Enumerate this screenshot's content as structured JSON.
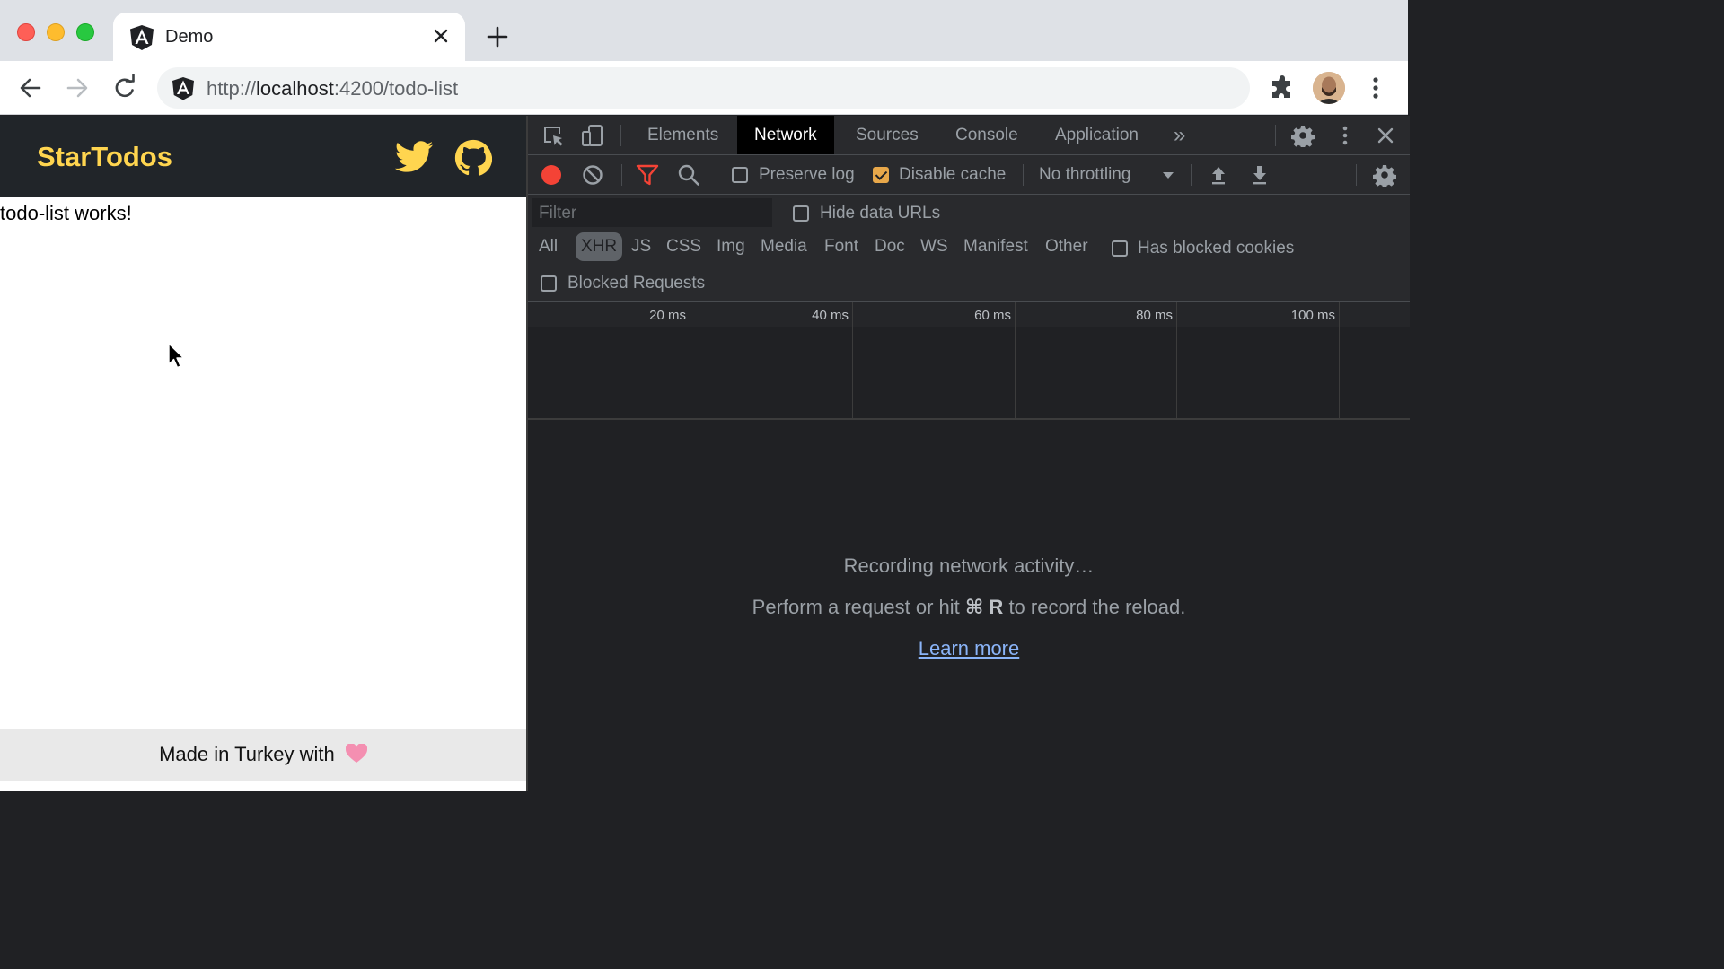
{
  "browser": {
    "tab_title": "Demo",
    "url_prefix": "http://",
    "url_host": "localhost",
    "url_rest": ":4200/todo-list"
  },
  "app": {
    "brand": "StarTodos",
    "content_text": "todo-list works!",
    "footer_text": "Made in Turkey with",
    "colors": {
      "header_bg": "#212529",
      "brand": "#ffd54f",
      "heart": "#f48fb1"
    }
  },
  "devtools": {
    "tabs": [
      "Elements",
      "Network",
      "Sources",
      "Console",
      "Application"
    ],
    "active_tab": "Network",
    "more_tabs_glyph": "»",
    "toolbar": {
      "preserve_log": "Preserve log",
      "preserve_log_checked": false,
      "disable_cache": "Disable cache",
      "disable_cache_checked": true,
      "throttling": "No throttling"
    },
    "filter": {
      "placeholder": "Filter",
      "hide_data_urls": "Hide data URLs",
      "types": [
        "All",
        "XHR",
        "JS",
        "CSS",
        "Img",
        "Media",
        "Font",
        "Doc",
        "WS",
        "Manifest",
        "Other"
      ],
      "active_type": "XHR",
      "has_blocked_cookies": "Has blocked cookies",
      "blocked_requests": "Blocked Requests"
    },
    "timeline_ticks": [
      "20 ms",
      "40 ms",
      "60 ms",
      "80 ms",
      "100 ms"
    ],
    "empty_state": {
      "title": "Recording network activity…",
      "hint_before": "Perform a request or hit",
      "hint_key": "⌘ R",
      "hint_after": "to record the reload.",
      "learn_more": "Learn more"
    }
  }
}
